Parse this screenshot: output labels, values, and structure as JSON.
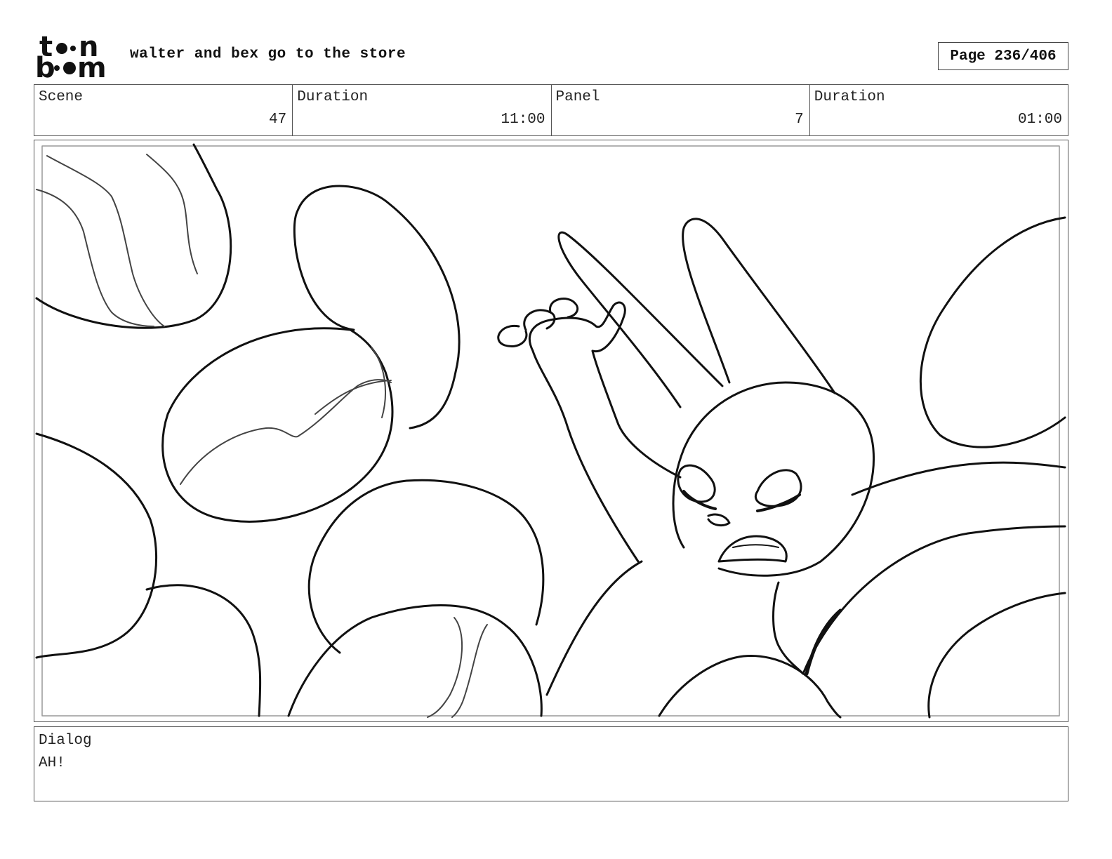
{
  "header": {
    "logo_top": "toon",
    "logo_bottom": "boom",
    "project_title": "walter and bex go to the store",
    "page_indicator": "Page 236/406"
  },
  "info": {
    "scene_label": "Scene",
    "scene_value": "47",
    "scene_duration_label": "Duration",
    "scene_duration_value": "11:00",
    "panel_label": "Panel",
    "panel_value": "7",
    "panel_duration_label": "Duration",
    "panel_duration_value": "01:00"
  },
  "dialog": {
    "label": "Dialog",
    "text": "AH!"
  },
  "colors": {
    "ink": "#111111",
    "frame": "#555555",
    "background": "#ffffff"
  }
}
